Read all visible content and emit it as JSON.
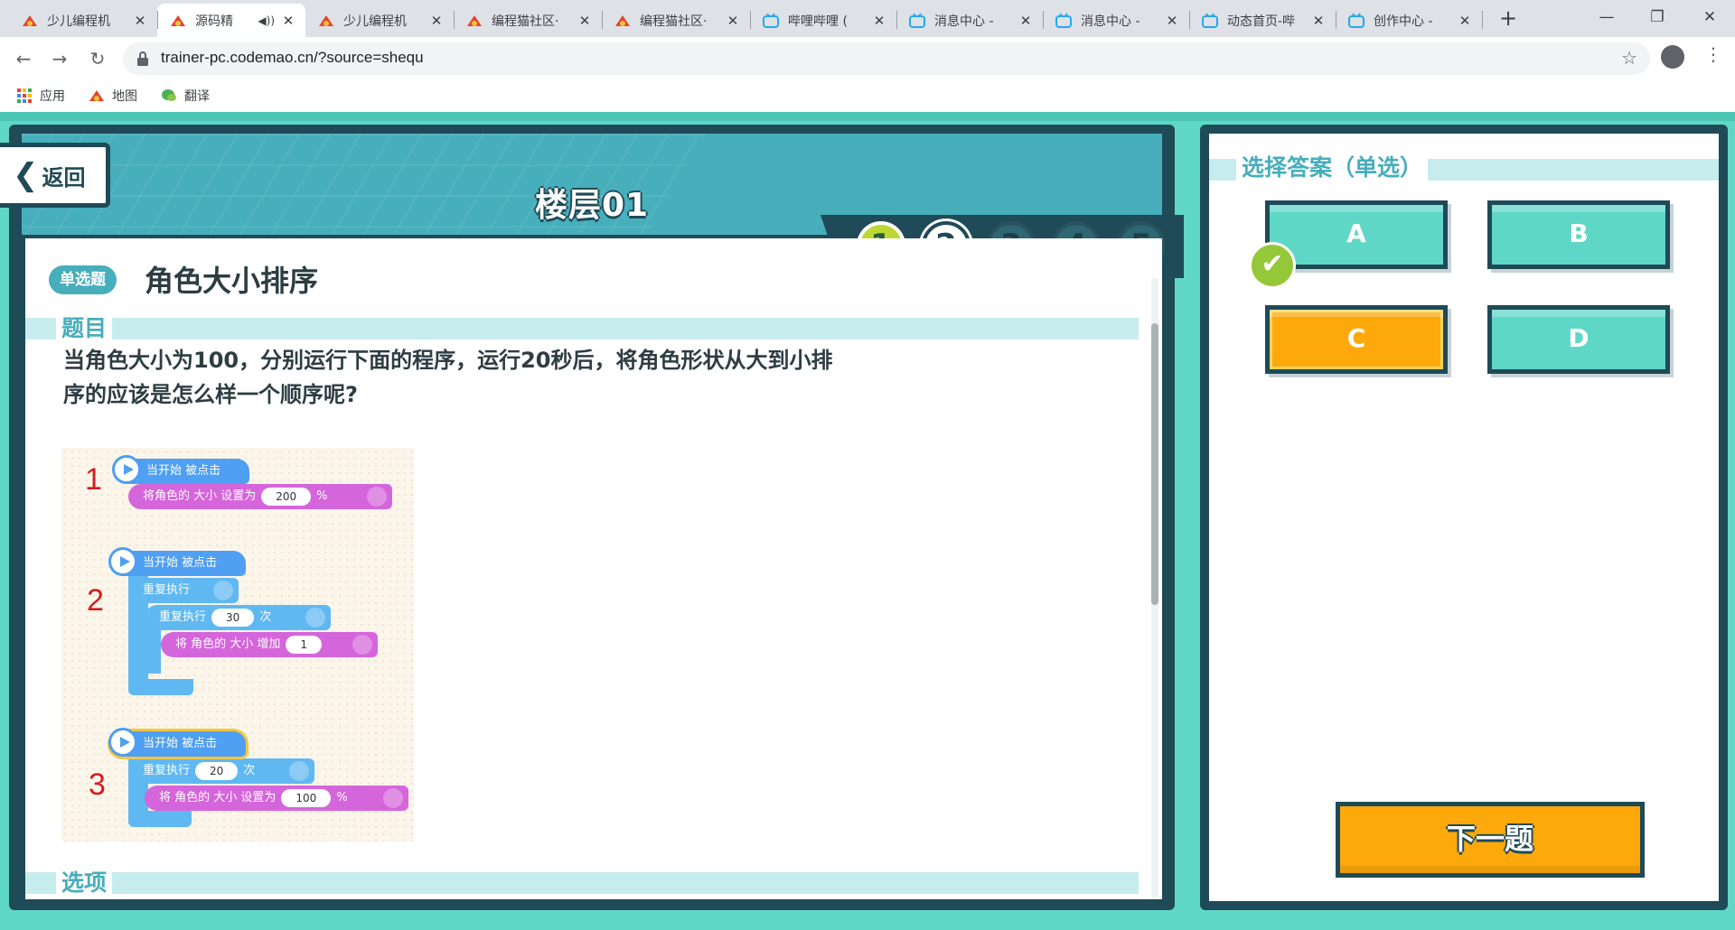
{
  "browser": {
    "tabs": [
      {
        "title": "少儿编程机",
        "favicon": "codemao-icon",
        "active": false
      },
      {
        "title": "源码精",
        "favicon": "codemao-icon",
        "active": true,
        "audio": true
      },
      {
        "title": "少儿编程机",
        "favicon": "codemao-icon",
        "active": false
      },
      {
        "title": "编程猫社区·",
        "favicon": "codemao-icon",
        "active": false
      },
      {
        "title": "编程猫社区·",
        "favicon": "codemao-icon",
        "active": false
      },
      {
        "title": "哔哩哔哩 (",
        "favicon": "bilibili-icon",
        "active": false
      },
      {
        "title": "消息中心 - ",
        "favicon": "bilibili-icon",
        "active": false
      },
      {
        "title": "消息中心 - ",
        "favicon": "bilibili-icon",
        "active": false
      },
      {
        "title": "动态首页-哔",
        "favicon": "bilibili-icon",
        "active": false
      },
      {
        "title": "创作中心 - ",
        "favicon": "bilibili-icon",
        "active": false
      }
    ],
    "url": "trainer-pc.codemao.cn/?source=shequ",
    "bookmarks": [
      {
        "label": "应用",
        "icon": "apps-grid-icon"
      },
      {
        "label": "地图",
        "icon": "codemao-icon"
      },
      {
        "label": "翻译",
        "icon": "wechat-icon"
      }
    ]
  },
  "header": {
    "back_label": "返回",
    "floor_title": "楼层01",
    "steps": [
      {
        "label": "1",
        "state": "done"
      },
      {
        "label": "2",
        "state": "current"
      },
      {
        "label": "3",
        "state": "pending"
      },
      {
        "label": "4",
        "state": "pending"
      },
      {
        "label": "5",
        "state": "pending"
      }
    ]
  },
  "question": {
    "type_badge": "单选题",
    "title": "角色大小排序",
    "section_label": "题目",
    "text": "当角色大小为100，分别运行下面的程序，运行20秒后，将角色形状从大到小排序的应该是怎么样一个顺序呢?",
    "options_section_label": "选项",
    "programs": [
      {
        "number": "1",
        "event": "当开始 被点击",
        "action_prefix": "将角色的 大小 设置为",
        "action_value": "200",
        "action_suffix": "%"
      },
      {
        "number": "2",
        "event": "当开始 被点击",
        "loop_forever": "重复执行",
        "loop_times_prefix": "重复执行",
        "loop_times_value": "30",
        "loop_times_suffix": "次",
        "action_prefix": "将 角色的 大小 增加",
        "action_value": "1"
      },
      {
        "number": "3",
        "event": "当开始 被点击",
        "loop_times_prefix": "重复执行",
        "loop_times_value": "20",
        "loop_times_suffix": "次",
        "action_prefix": "将 角色的 大小 设置为",
        "action_value": "100",
        "action_suffix": "%"
      }
    ]
  },
  "answer": {
    "section_label": "选择答案（单选）",
    "options": [
      "A",
      "B",
      "C",
      "D"
    ],
    "highlighted": "C",
    "checked": "A",
    "next_label": "下一题"
  },
  "colors": {
    "teal": "#47aebb",
    "dark": "#1f4a57",
    "mint": "#5fd7c6",
    "orange": "#fda90b",
    "green_check": "#95c838"
  }
}
